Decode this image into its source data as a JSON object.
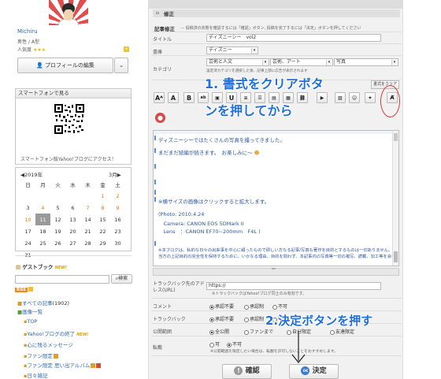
{
  "sidebar": {
    "username": "Michiru",
    "gender": "男性 / A型",
    "popularity": "人気度",
    "stars": "★★★",
    "profile_edit": "プロフィールの編集",
    "phone_title": "スマートフォンで見る",
    "phone_caption": "スマートフォン版Yahoo!ブログにアクセス！",
    "calendar": {
      "prev": "◀2019年",
      "next": "3月▶",
      "weekdays": [
        "日",
        "月",
        "火",
        "水",
        "木",
        "金",
        "土"
      ],
      "rows": [
        [
          "",
          "",
          "",
          "",
          "",
          "1",
          "2"
        ],
        [
          "3",
          "4",
          "5",
          "6",
          "7",
          "8",
          "9"
        ],
        [
          "10",
          "11",
          "12",
          "13",
          "14",
          "15",
          "16"
        ],
        [
          "17",
          "18",
          "19",
          "20",
          "21",
          "22",
          "23"
        ],
        [
          "24",
          "25",
          "26",
          "27",
          "28",
          "29",
          "30"
        ],
        [
          "31",
          "",
          "",
          "",
          "",
          "",
          ""
        ]
      ]
    },
    "guestbook": "ゲストブック",
    "new_badge": "NEW!",
    "search": "検索",
    "rss": "RSS",
    "all_articles": "すべての記事",
    "all_count": "(1902)",
    "list_title": "画像一覧",
    "links": [
      "TOP",
      "Yahoo!ブログの終了",
      "心に残るメッセージ",
      "ファン限定",
      "ファン限定 思い出アルバム",
      "日々雑記"
    ]
  },
  "main": {
    "section_title": "修正",
    "edit_label": "記事修正",
    "edit_hint": "－ 投稿済の状態を確認するには「確認」ボタン, 投稿を完了するには「決定」ボタンを押してください",
    "title_label": "タイトル",
    "title_value": "ディズニーシー　vol2",
    "shoko_label": "書庫",
    "shoko_value": "ディズニー",
    "category_label": "カテゴリ",
    "category_values": [
      "芸術と人文",
      "芸術、アート",
      "写真"
    ],
    "category_hint": "設定済カテゴリを選択した後、記事上部に広告が表示されます",
    "clear_format_label": "書式をクリア",
    "editor_lines": [
      "ディズニーシーではたくさんの写真を撮ってきました。",
      "まだまだ続編が続きます。　お楽しみに～",
      "",
      "",
      "",
      "※横サイズの画像はクリックすると拡大します。",
      "",
      "(Photo: 2010.4.24",
      "　Camera: CANON EOS 5DMark II",
      "　Lens　：CANON EF70~200mm　F4L )"
    ],
    "editor_small": [
      "※本ブログは、私的な日々の出来事を中心に綴ったもので即しい方なる記事/写真も著作を目的とするものは一切ありません。",
      "当方の上記目的の完全性を保持するために、いかなる理由、目的を問わず、本記事内の写真等一切の複写、読載、加工等を会むダウンロード行為を固く禁止します。"
    ],
    "trackback_url_label": "トラックバック先のアドレス(URL)",
    "trackback_url_value": "https://",
    "trackback_url_hint": "※トラックバックはYahoo!ブログ同士のみ有効です。",
    "comment_label": "コメント",
    "comment_options": [
      "承認不要",
      "承認制",
      "不可"
    ],
    "trackback_label": "トラックバック",
    "trackback_options": [
      "承認不要",
      "承認制",
      "不可"
    ],
    "publish_label": "公開範囲",
    "publish_options": [
      "全公開",
      "ファンまで",
      "自分限定",
      "友達限定"
    ],
    "transfer_label": "転載",
    "transfer_options": [
      "可",
      "不可"
    ],
    "transfer_hint": "※公開範囲を限定したい場合は、転載を許可しないことをおすすめします。",
    "confirm_button": "確認",
    "decide_button": "決定",
    "ok_icon_text": "OK"
  },
  "annotations": {
    "step1_line1": "1. 書式をクリアボタ",
    "step1_line2": "ンを押してから",
    "step2": "2.決定ボタンを押す",
    "color": "#1f6fe0"
  }
}
